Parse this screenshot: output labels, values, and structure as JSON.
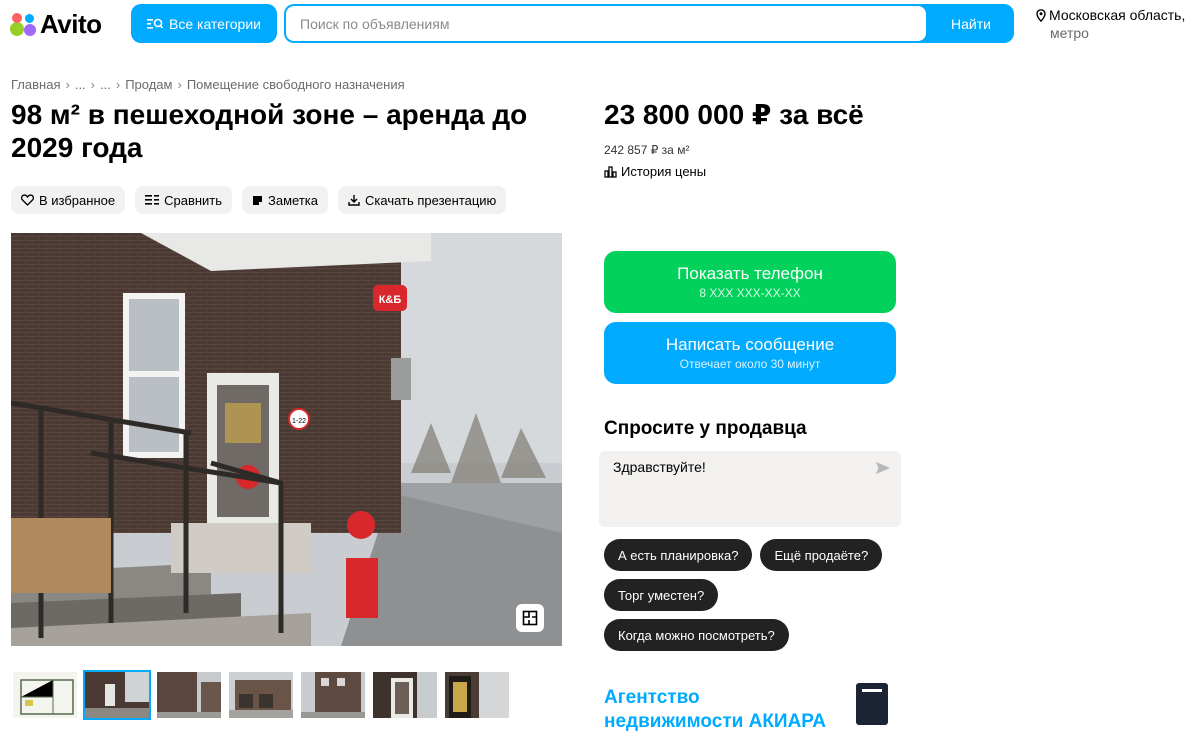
{
  "header": {
    "logo_text": "Avito",
    "categories_label": "Все категории",
    "search_placeholder": "Поиск по объявлениям",
    "search_button": "Найти",
    "location": "Московская область,",
    "location_sub": "метро"
  },
  "breadcrumbs": [
    "Главная",
    "...",
    "...",
    "Продам",
    "Помещение свободного назначения"
  ],
  "listing": {
    "title": "98 м² в пешеходной зоне – аренда до 2029 года",
    "price": "23 800 000 ₽ за всё",
    "price_per_m2": "242 857 ₽ за м²",
    "price_history": "История цены"
  },
  "actions": {
    "favorite": "В избранное",
    "compare": "Сравнить",
    "note": "Заметка",
    "download": "Скачать презентацию"
  },
  "photo": {
    "sign_text": "К&Б",
    "door_sticker": "1-22"
  },
  "contact": {
    "phone_label": "Показать телефон",
    "phone_sub": "8 XXX XXX-XX-XX",
    "message_label": "Написать сообщение",
    "message_sub": "Отвечает около 30 минут"
  },
  "ask": {
    "title": "Спросите у продавца",
    "message": "Здравствуйте!",
    "quick_questions": [
      "А есть планировка?",
      "Ещё продаёте?",
      "Торг уместен?",
      "Когда можно посмотреть?"
    ]
  },
  "seller": {
    "name": "Агентство недвижимости АКИАРА"
  },
  "colors": {
    "accent_blue": "#00aaff",
    "phone_green": "#02d15c",
    "chip_bg": "#f2f1f0"
  }
}
